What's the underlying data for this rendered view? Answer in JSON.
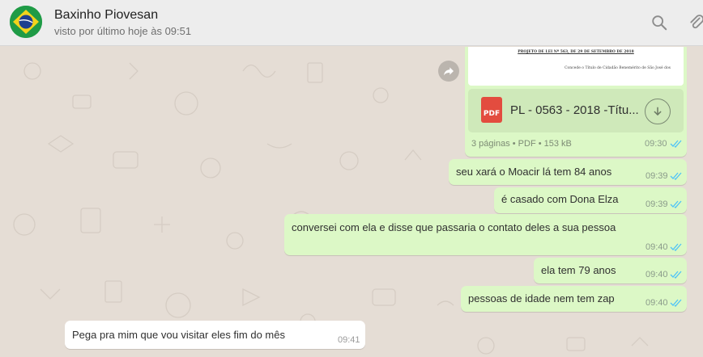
{
  "contact": {
    "name": "Baxinho Piovesan",
    "status": "visto por último hoje às 09:51"
  },
  "header_icons": [
    "search-icon",
    "attach-icon"
  ],
  "document": {
    "preview_line1": "PROJETO DE LEI Nº 563, DE 29 DE SETEMBRO DE 2018",
    "preview_line2": "Concede o Título de Cidadão Benemérito de São José dos",
    "file_type_badge": "PDF",
    "file_name": "PL - 0563 - 2018 -Títu...",
    "meta": "3 páginas • PDF • 153 kB",
    "time": "09:30",
    "status": "read"
  },
  "messages": [
    {
      "direction": "out",
      "text": "seu xará o Moacir lá tem 84 anos",
      "time": "09:39",
      "status": "read"
    },
    {
      "direction": "out",
      "text": "é casado com Dona Elza",
      "time": "09:39",
      "status": "read"
    },
    {
      "direction": "out",
      "text": "conversei com ela e disse que passaria o contato deles a sua pessoa",
      "time": "09:40",
      "status": "read"
    },
    {
      "direction": "out",
      "text": "ela tem 79 anos",
      "time": "09:40",
      "status": "read"
    },
    {
      "direction": "out",
      "text": "pessoas de idade nem tem zap",
      "time": "09:40",
      "status": "read"
    },
    {
      "direction": "in",
      "text": "Pega pra mim que vou visitar eles fim do mês",
      "time": "09:41"
    }
  ],
  "colors": {
    "chat_background": "#e5ddd5",
    "outgoing_bubble": "#dcf8c6",
    "incoming_bubble": "#ffffff",
    "read_ticks": "#4fc3f7",
    "header": "#ededed"
  }
}
